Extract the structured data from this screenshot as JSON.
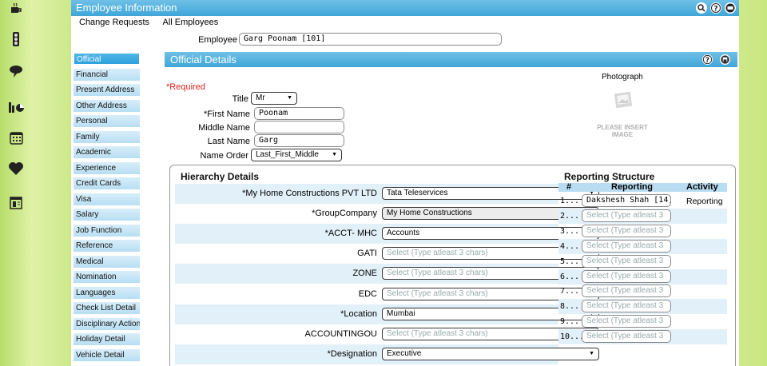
{
  "window": {
    "title": "Employee Information"
  },
  "subnav": [
    "Change Requests",
    "All Employees"
  ],
  "employee": {
    "label": "Employee",
    "value": "Garg Poonam [101]"
  },
  "sidemenu": [
    "Official",
    "Financial",
    "Present Address",
    "Other Address",
    "Personal",
    "Family",
    "Academic",
    "Experience",
    "Credit Cards",
    "Visa",
    "Salary",
    "Job Function",
    "Reference",
    "Medical",
    "Nomination",
    "Languages",
    "Check List Detail",
    "Disciplinary Action",
    "Holiday Detail",
    "Vehicle Detail"
  ],
  "official": {
    "title": "Official Details",
    "required": "*Required",
    "photo_label": "Photograph",
    "photo_placeholder": "PLEASE INSERT IMAGE",
    "fields": {
      "title": {
        "label": "Title",
        "value": "Mr"
      },
      "first": {
        "label": "*First Name",
        "value": "Poonam"
      },
      "middle": {
        "label": "Middle Name",
        "value": ""
      },
      "last": {
        "label": "Last Name",
        "value": "Garg"
      },
      "order": {
        "label": "Name Order",
        "value": "Last_First_Middle"
      }
    }
  },
  "hierarchy": {
    "title": "Hierarchy Details",
    "rows": [
      {
        "label": "*My Home Constructions PVT LTD",
        "value": "Tata Teleservices",
        "placeholder": false
      },
      {
        "label": "*GroupCompany",
        "value": "My Home Constructions",
        "placeholder": false
      },
      {
        "label": "*ACCT- MHC",
        "value": "Accounts",
        "placeholder": false
      },
      {
        "label": "GATI",
        "value": "Select (Type atleast 3 chars)",
        "placeholder": true
      },
      {
        "label": "ZONE",
        "value": "Select (Type atleast 3 chars)",
        "placeholder": true
      },
      {
        "label": "EDC",
        "value": "Select (Type atleast 3 chars)",
        "placeholder": true
      },
      {
        "label": "*Location",
        "value": "Mumbai",
        "placeholder": false
      },
      {
        "label": "ACCOUNTINGOU",
        "value": "Select (Type atleast 3 chars)",
        "placeholder": true
      },
      {
        "label": "*Designation",
        "value": "Executive",
        "placeholder": false
      }
    ]
  },
  "reporting": {
    "title": "Reporting Structure",
    "headers": [
      "#",
      "Reporting",
      "Activity"
    ],
    "rows": [
      {
        "num": "1...",
        "value": "Dakshesh Shah [14]",
        "activity": "Reporting"
      },
      {
        "num": "2...",
        "value": "Select (Type atleast 3",
        "activity": ""
      },
      {
        "num": "3...",
        "value": "Select (Type atleast 3",
        "activity": ""
      },
      {
        "num": "4...",
        "value": "Select (Type atleast 3",
        "activity": ""
      },
      {
        "num": "5...",
        "value": "Select (Type atleast 3",
        "activity": ""
      },
      {
        "num": "6...",
        "value": "Select (Type atleast 3",
        "activity": ""
      },
      {
        "num": "7...",
        "value": "Select (Type atleast 3",
        "activity": ""
      },
      {
        "num": "8...",
        "value": "Select (Type atleast 3",
        "activity": ""
      },
      {
        "num": "9...",
        "value": "Select (Type atleast 3",
        "activity": ""
      },
      {
        "num": "10...",
        "value": "Select (Type atleast 3",
        "activity": ""
      }
    ]
  },
  "icons": {
    "leftbar": [
      "coffee-cup-icon",
      "traffic-light-icon",
      "speech-bubble-icon",
      "chart-icon",
      "calendar-icon",
      "heart-icon",
      "document-list-icon"
    ],
    "titlebar": [
      "search-icon",
      "help-icon",
      "faq-icon"
    ],
    "detailbar": [
      "help-icon",
      "save-icon"
    ]
  },
  "colors": {
    "header": "#3fa6d8",
    "menu_active": "#2ea0dd",
    "menu_item": "#b7def3",
    "background": "#cde98a"
  }
}
